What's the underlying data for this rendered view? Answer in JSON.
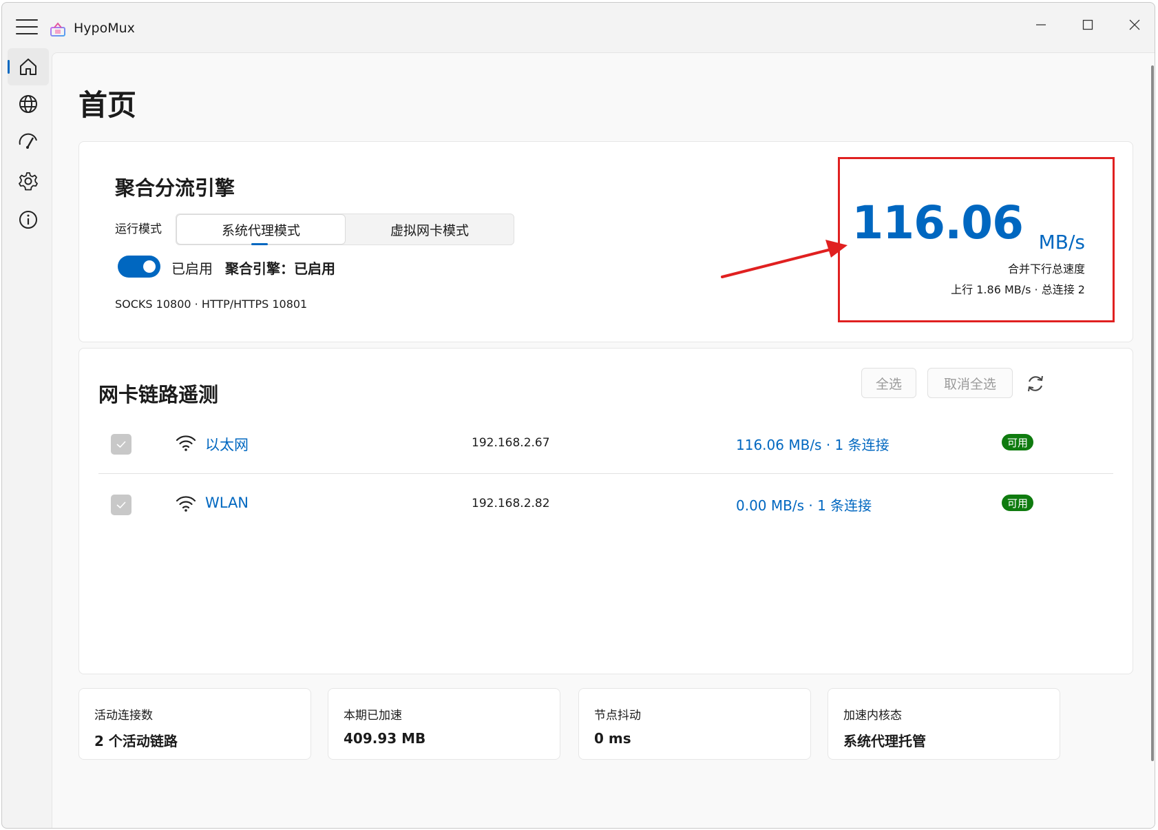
{
  "app": {
    "title": "HypoMux"
  },
  "window_controls": {
    "minimize_icon": "minimize-icon",
    "maximize_icon": "maximize-icon",
    "close_icon": "close-icon"
  },
  "nav": {
    "items": [
      {
        "icon": "home-icon",
        "active": true
      },
      {
        "icon": "globe-icon",
        "active": false
      },
      {
        "icon": "speedometer-icon",
        "active": false
      },
      {
        "icon": "gear-icon",
        "active": false
      },
      {
        "icon": "info-icon",
        "active": false
      }
    ]
  },
  "page": {
    "title": "首页"
  },
  "engine": {
    "title": "聚合分流引擎",
    "mode_label": "运行模式",
    "modes": [
      "系统代理模式",
      "虚拟网卡模式"
    ],
    "selected_mode": "系统代理模式",
    "toggle_on": true,
    "toggle_label": "已启用",
    "status_text": "聚合引擎：已启用",
    "ports": "SOCKS 10800 · HTTP/HTTPS 10801"
  },
  "speed": {
    "value": "116.06",
    "unit": "MB/s",
    "caption": "合并下行总速度",
    "sub": "上行 1.86 MB/s · 总连接 2",
    "highlight_color": "#e02020"
  },
  "telemetry": {
    "title": "网卡链路遥测",
    "select_all": "全选",
    "deselect_all": "取消全选",
    "refresh_icon": "refresh-icon",
    "rows": [
      {
        "name": "以太网",
        "ip": "192.168.2.67",
        "rate": "116.06 MB/s · 1 条连接",
        "badge": "可用",
        "checked": true,
        "icon": "wifi-icon"
      },
      {
        "name": "WLAN",
        "ip": "192.168.2.82",
        "rate": "0.00 MB/s · 1 条连接",
        "badge": "可用",
        "checked": true,
        "icon": "wifi-icon"
      }
    ]
  },
  "stats": [
    {
      "label": "活动连接数",
      "value": "2 个活动链路"
    },
    {
      "label": "本期已加速",
      "value": "409.93 MB"
    },
    {
      "label": "节点抖动",
      "value": "0 ms"
    },
    {
      "label": "加速内核态",
      "value": "系统代理托管"
    }
  ],
  "colors": {
    "accent": "#0067c0",
    "badge_green": "#0f7b0f"
  }
}
